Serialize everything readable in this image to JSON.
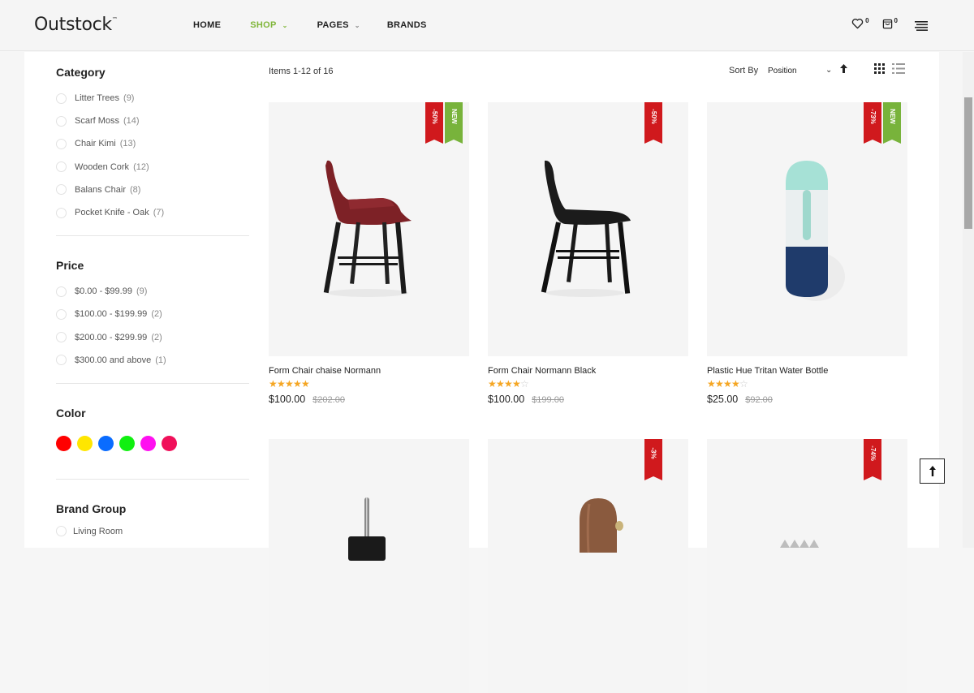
{
  "header": {
    "logo": "Outstock",
    "logo_tm": "™",
    "nav": [
      {
        "label": "HOME",
        "active": false,
        "dropdown": false
      },
      {
        "label": "SHOP",
        "active": true,
        "dropdown": true
      },
      {
        "label": "PAGES",
        "active": false,
        "dropdown": true
      },
      {
        "label": "BRANDS",
        "active": false,
        "dropdown": false
      }
    ],
    "wishlist_count": "0",
    "cart_count": "0",
    "icons": [
      "heart-icon",
      "cart-icon",
      "menu-icon"
    ],
    "accent_color": "#80b63a"
  },
  "sidebar": {
    "category": {
      "title": "Category",
      "items": [
        {
          "label": "Litter Trees",
          "count": "(9)"
        },
        {
          "label": "Scarf Moss",
          "count": "(14)"
        },
        {
          "label": "Chair Kimi",
          "count": "(13)"
        },
        {
          "label": "Wooden Cork",
          "count": "(12)"
        },
        {
          "label": "Balans Chair",
          "count": "(8)"
        },
        {
          "label": "Pocket Knife - Oak",
          "count": "(7)"
        }
      ]
    },
    "price": {
      "title": "Price",
      "items": [
        {
          "label": "$0.00 - $99.99",
          "count": "(9)"
        },
        {
          "label": "$100.00 - $199.99",
          "count": "(2)"
        },
        {
          "label": "$200.00 - $299.99",
          "count": "(2)"
        },
        {
          "label": "$300.00 and above",
          "count": "(1)"
        }
      ]
    },
    "color": {
      "title": "Color",
      "swatches": [
        "#ff0000",
        "#ffe600",
        "#0a6cff",
        "#10f010",
        "#ff10f0",
        "#f0105a"
      ]
    },
    "brand_group": {
      "title": "Brand Group",
      "items": [
        {
          "label": "Living Room"
        }
      ]
    }
  },
  "toolbar": {
    "items_count": "Items 1-12 of 16",
    "sort_label": "Sort By",
    "sort_value": "Position",
    "sort_direction": "ascending"
  },
  "products": [
    {
      "name": "Form Chair chaise Normann",
      "rating": 5,
      "price": "$100.00",
      "old_price": "$202.00",
      "badges": [
        {
          "type": "sale",
          "text": "-50%"
        },
        {
          "type": "new",
          "text": "NEW"
        }
      ],
      "image": "red-armchair"
    },
    {
      "name": "Form Chair Normann Black",
      "rating": 4,
      "price": "$100.00",
      "old_price": "$199.00",
      "badges": [
        {
          "type": "sale",
          "text": "-50%"
        }
      ],
      "image": "black-chair"
    },
    {
      "name": "Plastic Hue Tritan Water Bottle",
      "rating": 4,
      "price": "$25.00",
      "old_price": "$92.00",
      "badges": [
        {
          "type": "sale",
          "text": "-73%"
        },
        {
          "type": "new",
          "text": "NEW"
        }
      ],
      "image": "water-bottle"
    },
    {
      "name": "",
      "badges": [],
      "image": "black-pen-holder"
    },
    {
      "name": "",
      "badges": [
        {
          "type": "sale",
          "text": "-3%"
        }
      ],
      "image": "wooden-figure"
    },
    {
      "name": "",
      "badges": [
        {
          "type": "sale",
          "text": "-74%"
        }
      ],
      "image": "spiky-object"
    }
  ],
  "sale_color": "#d0191d",
  "new_color": "#78b33b",
  "star_color": "#f5a623"
}
